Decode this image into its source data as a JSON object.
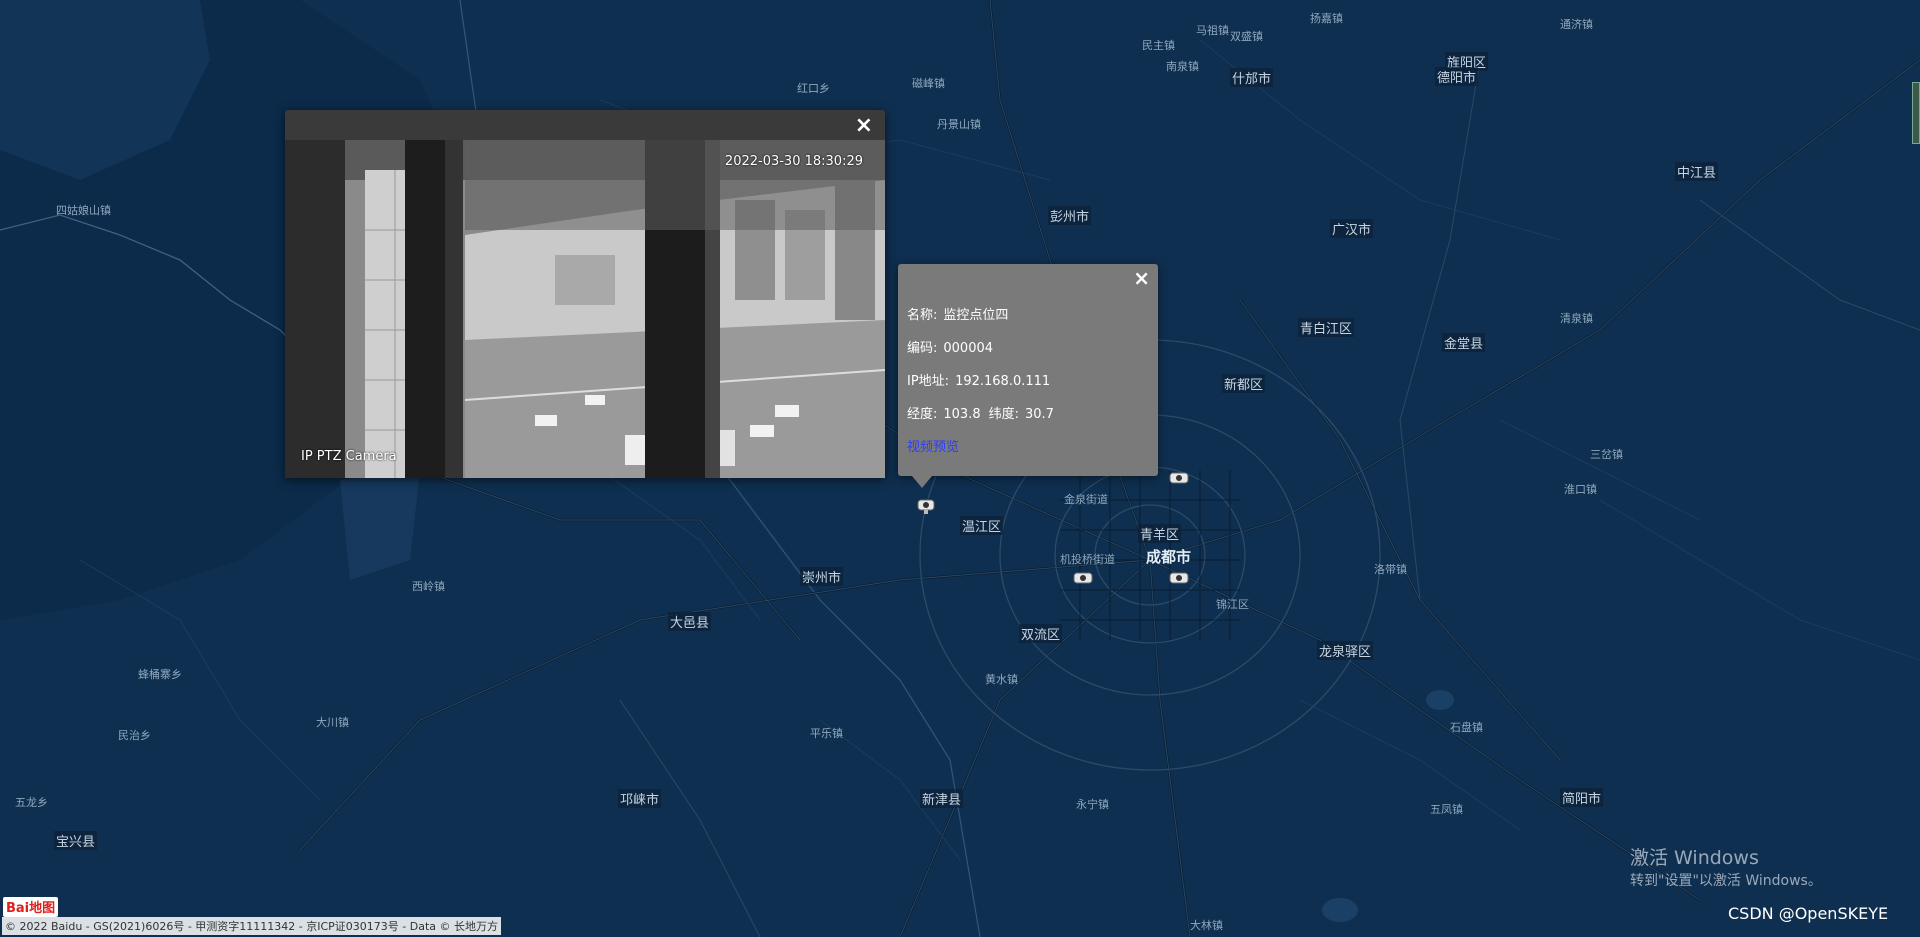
{
  "map": {
    "labels": [
      {
        "text": "扬嘉镇",
        "cls": ""
      },
      {
        "text": "通济镇",
        "cls": ""
      },
      {
        "text": "马祖镇",
        "cls": ""
      },
      {
        "text": "双盛镇",
        "cls": ""
      },
      {
        "text": "民主镇",
        "cls": ""
      },
      {
        "text": "南泉镇",
        "cls": ""
      },
      {
        "text": "旌阳区",
        "cls": "city"
      },
      {
        "text": "德阳市",
        "cls": "city"
      },
      {
        "text": "什邡市",
        "cls": "city"
      },
      {
        "text": "四姑娘山镇",
        "cls": ""
      },
      {
        "text": "红口乡",
        "cls": ""
      },
      {
        "text": "磁峰镇",
        "cls": ""
      },
      {
        "text": "丹景山镇",
        "cls": ""
      },
      {
        "text": "彭州市",
        "cls": "city"
      },
      {
        "text": "广汉市",
        "cls": "city"
      },
      {
        "text": "中江县",
        "cls": "city"
      },
      {
        "text": "青白江区",
        "cls": "city"
      },
      {
        "text": "新都区",
        "cls": "city"
      },
      {
        "text": "金堂县",
        "cls": "city"
      },
      {
        "text": "温江区",
        "cls": "city"
      },
      {
        "text": "青羊区",
        "cls": "city"
      },
      {
        "text": "成都市",
        "cls": "big"
      },
      {
        "text": "崇州市",
        "cls": "city"
      },
      {
        "text": "大邑县",
        "cls": "city"
      },
      {
        "text": "双流区",
        "cls": "city"
      },
      {
        "text": "龙泉驿区",
        "cls": "city"
      },
      {
        "text": "新津县",
        "cls": "city"
      },
      {
        "text": "邛崃市",
        "cls": "city"
      },
      {
        "text": "简阳市",
        "cls": "city"
      },
      {
        "text": "宝兴县",
        "cls": "city"
      },
      {
        "text": "机投桥街道",
        "cls": ""
      },
      {
        "text": "金泉街道",
        "cls": ""
      },
      {
        "text": "锦江区",
        "cls": ""
      },
      {
        "text": "西岭镇",
        "cls": ""
      },
      {
        "text": "大川镇",
        "cls": ""
      },
      {
        "text": "民治乡",
        "cls": ""
      },
      {
        "text": "五龙乡",
        "cls": ""
      },
      {
        "text": "蜂桶寨乡",
        "cls": ""
      },
      {
        "text": "永宁镇",
        "cls": ""
      },
      {
        "text": "黄水镇",
        "cls": ""
      },
      {
        "text": "平乐镇",
        "cls": ""
      },
      {
        "text": "三岔镇",
        "cls": ""
      },
      {
        "text": "淮口镇",
        "cls": ""
      },
      {
        "text": "清泉镇",
        "cls": ""
      },
      {
        "text": "洛带镇",
        "cls": ""
      },
      {
        "text": "五凤镇",
        "cls": ""
      },
      {
        "text": "石盘镇",
        "cls": ""
      },
      {
        "text": "大林镇",
        "cls": ""
      }
    ],
    "cameras": [
      "camera-1",
      "camera-2",
      "camera-3",
      "camera-4"
    ]
  },
  "video_popup": {
    "close_label": "×",
    "timestamp": "2022-03-30 18:30:29",
    "camera_name": "IP PTZ Camera"
  },
  "info_popup": {
    "close_label": "×",
    "name_key": "名称:",
    "name_value": "监控点位四",
    "code_key": "编码:",
    "code_value": "000004",
    "ip_key": "IP地址:",
    "ip_value": "192.168.0.111",
    "lng_key": "经度:",
    "lng_value": "103.8",
    "lat_key": "纬度:",
    "lat_value": "30.7",
    "link": "视频预览"
  },
  "footer": {
    "copyright": "© 2022 Baidu - GS(2021)6026号 - 甲测资字11111342 - 京ICP证030173号 - Data © 长地万方",
    "logo": "Bai地图"
  },
  "watermark": {
    "line1": "激活 Windows",
    "line2": "转到\"设置\"以激活 Windows。"
  },
  "credit": "CSDN @OpenSKEYE"
}
